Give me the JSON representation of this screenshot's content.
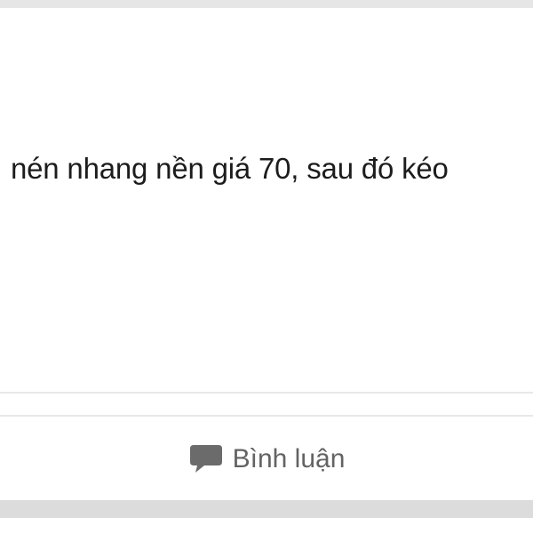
{
  "post": {
    "text": "nén nhang nền giá 70, sau đó kéo"
  },
  "actions": {
    "comment_icon": "speech-bubble-icon",
    "comment_label": "Bình luận"
  },
  "colors": {
    "text": "#1c1c1c",
    "action_text": "#636363",
    "icon": "#6b6b6b",
    "separator": "#dcdcdc"
  }
}
